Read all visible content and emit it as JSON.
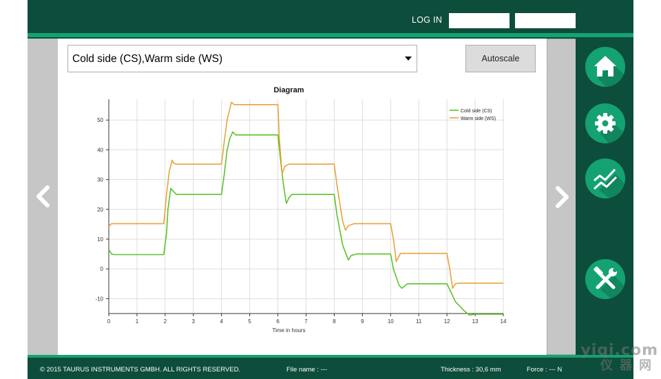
{
  "header": {
    "login_label": "LOG IN",
    "username_value": "",
    "password_value": ""
  },
  "toolbar": {
    "channel_selected": "Cold side (CS),Warm side (WS)",
    "autoscale_label": "Autoscale"
  },
  "sidebar": {
    "items": [
      {
        "icon": "home-icon"
      },
      {
        "icon": "gear-icon"
      },
      {
        "icon": "chart-icon"
      },
      {
        "icon": "tools-icon"
      }
    ]
  },
  "footer": {
    "copyright": "© 2015 TAURUS INSTRUMENTS GMBH. ALL RIGHTS RESERVED.",
    "file_name": "File name :  ---",
    "thickness": "Thickness :  30,6  mm",
    "force": "Force :  ---  N"
  },
  "watermark": {
    "text": "yiqi.com",
    "sub": "仪器网"
  },
  "colors": {
    "dark_green": "#0d4d3b",
    "accent_green": "#15a273",
    "cold_side": "#5ac326",
    "warm_side": "#e8a23a"
  },
  "chart_data": {
    "type": "line",
    "title": "Diagram",
    "xlabel": "Time in hours",
    "ylabel": "",
    "xlim": [
      0,
      14
    ],
    "ylim": [
      -15,
      57
    ],
    "x_ticks": [
      0,
      1,
      2,
      3,
      4,
      5,
      6,
      7,
      8,
      9,
      10,
      11,
      12,
      13,
      14
    ],
    "y_ticks": [
      -10,
      0,
      10,
      20,
      30,
      40,
      50
    ],
    "grid": true,
    "legend": "top-right",
    "series": [
      {
        "name": "Cold side (CS)",
        "color": "#5ac326",
        "x": [
          0,
          0.1,
          0.2,
          1.95,
          2.05,
          2.1,
          2.2,
          2.3,
          2.4,
          4.0,
          4.1,
          4.2,
          4.3,
          4.4,
          4.5,
          6.0,
          6.1,
          6.2,
          6.3,
          6.4,
          6.5,
          8.0,
          8.1,
          8.3,
          8.5,
          8.6,
          8.8,
          10.0,
          10.1,
          10.3,
          10.4,
          10.6,
          12.0,
          12.1,
          12.3,
          12.6,
          12.8,
          13.0,
          14.0
        ],
        "y": [
          6.5,
          5,
          4.8,
          4.8,
          12,
          20,
          27,
          26,
          25,
          25,
          32,
          40,
          44,
          46,
          45,
          45,
          36,
          28,
          22,
          24,
          25,
          25,
          18,
          8,
          3,
          4.5,
          5,
          5,
          0,
          -5.5,
          -6.5,
          -5,
          -5,
          -7,
          -11,
          -14,
          -15.5,
          -15.2,
          -15.2
        ]
      },
      {
        "name": "Warm side (WS)",
        "color": "#e8a23a",
        "x": [
          0,
          0.05,
          0.1,
          1.95,
          2.05,
          2.15,
          2.25,
          2.3,
          2.4,
          4.0,
          4.1,
          4.2,
          4.3,
          4.35,
          4.45,
          6.0,
          6.05,
          6.15,
          6.25,
          6.4,
          8.0,
          8.1,
          8.3,
          8.4,
          8.5,
          8.7,
          10.0,
          10.1,
          10.2,
          10.35,
          12.0,
          12.1,
          12.2,
          12.3,
          12.45,
          14.0
        ],
        "y": [
          14,
          14.8,
          15.2,
          15.2,
          25,
          33,
          36.5,
          35.5,
          35.2,
          35.2,
          43,
          50,
          54,
          56,
          55.2,
          55.2,
          44,
          32,
          34.5,
          35.2,
          35.2,
          28,
          16,
          13,
          14.5,
          15.2,
          15.2,
          10,
          2.5,
          5.2,
          5.2,
          0,
          -6.5,
          -5,
          -4.8,
          -4.8
        ]
      }
    ]
  }
}
